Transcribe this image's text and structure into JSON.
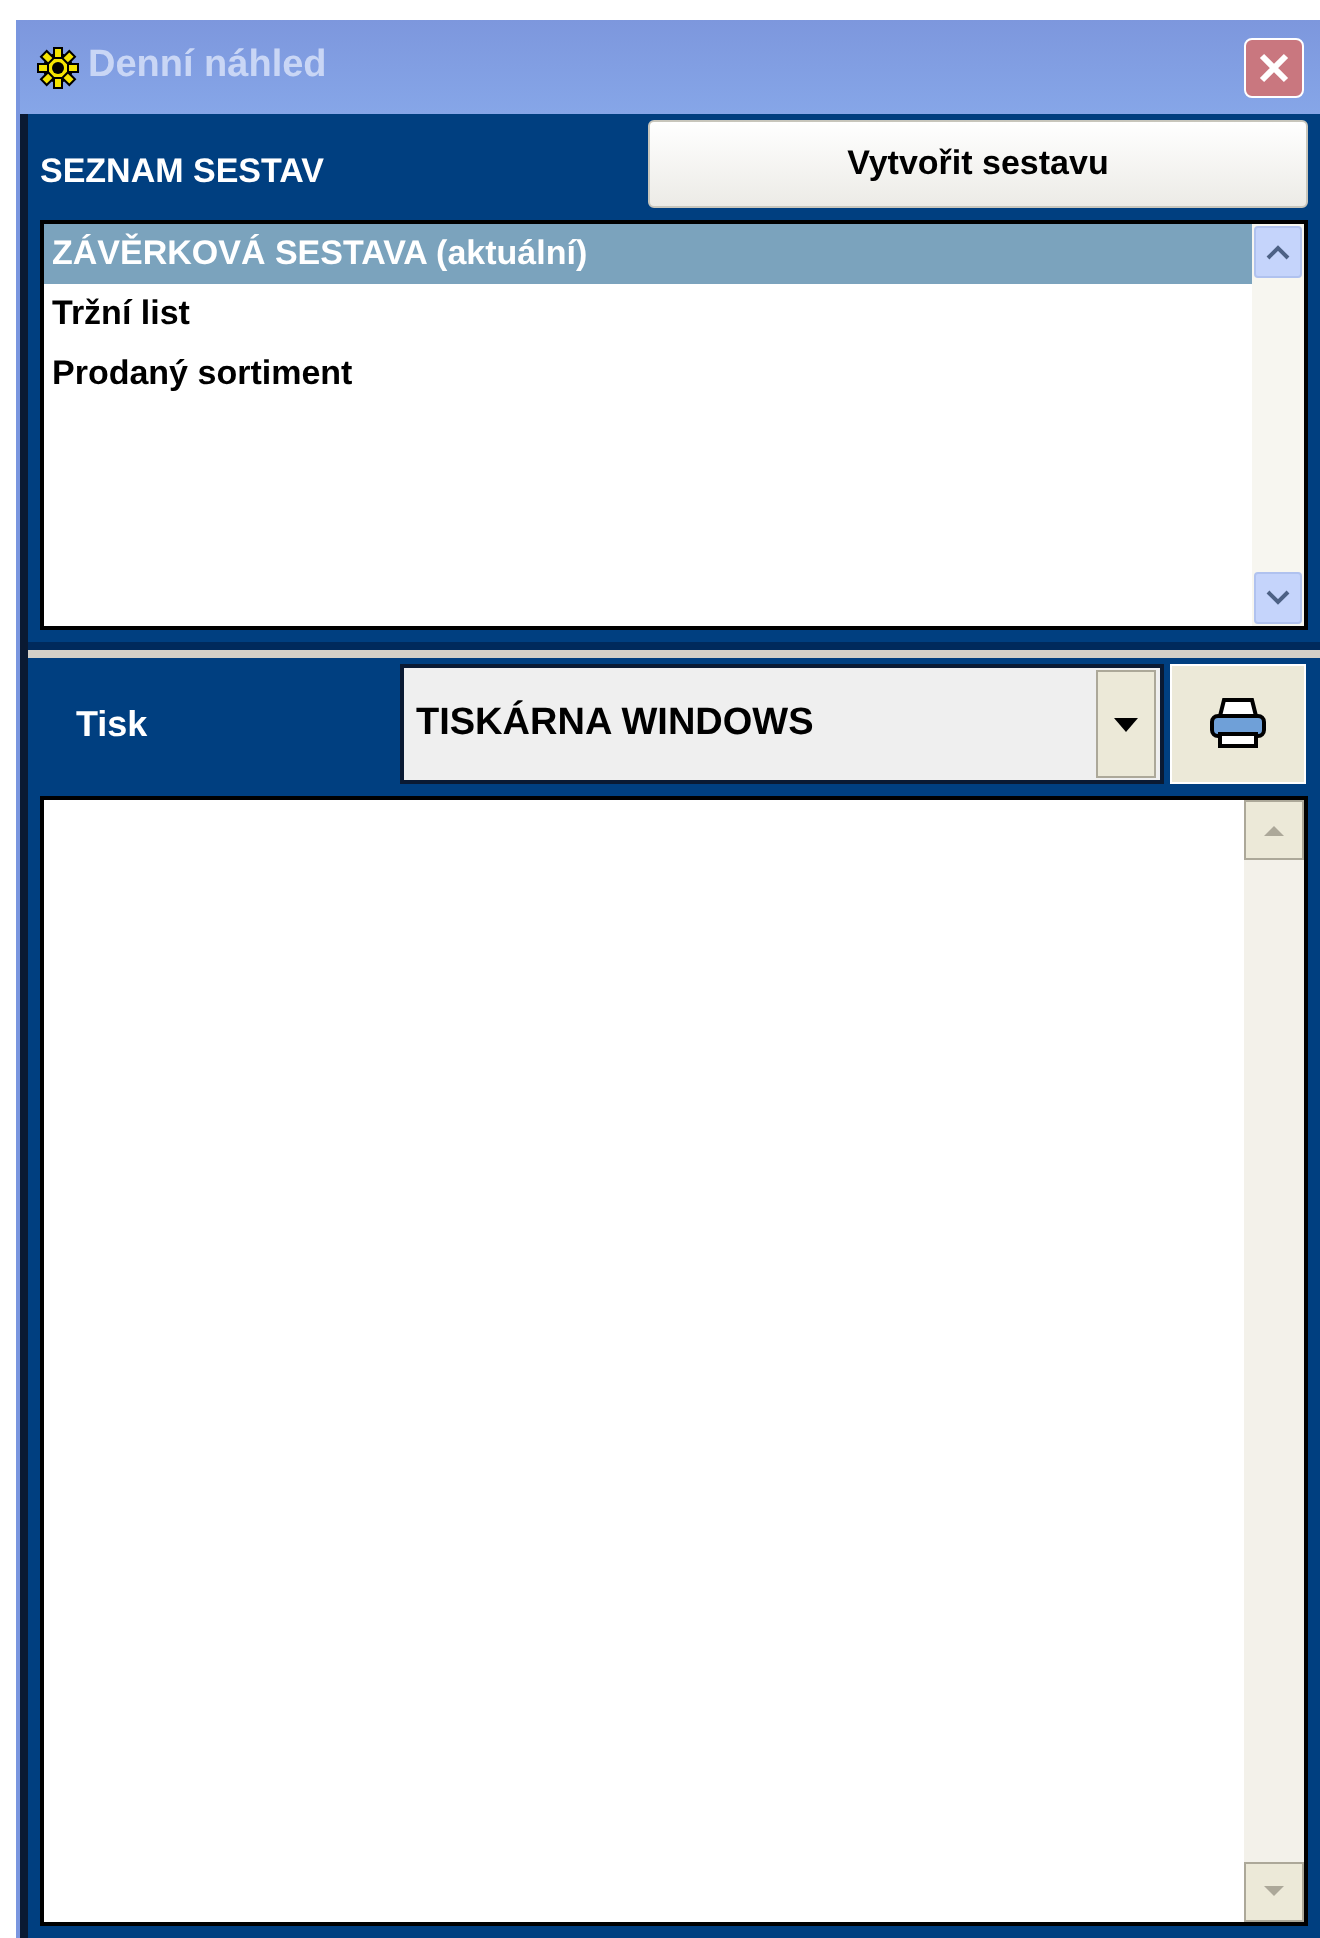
{
  "window": {
    "title": "Denní náhled"
  },
  "reports": {
    "label": "SEZNAM SESTAV",
    "create_button": "Vytvořit sestavu",
    "items": [
      {
        "label": "ZÁVĚRKOVÁ  SESTAVA  (aktuální)",
        "selected": true
      },
      {
        "label": "Tržní list",
        "selected": false
      },
      {
        "label": "Prodaný sortiment",
        "selected": false
      }
    ]
  },
  "print": {
    "label": "Tisk",
    "printer": "TISKÁRNA WINDOWS"
  }
}
